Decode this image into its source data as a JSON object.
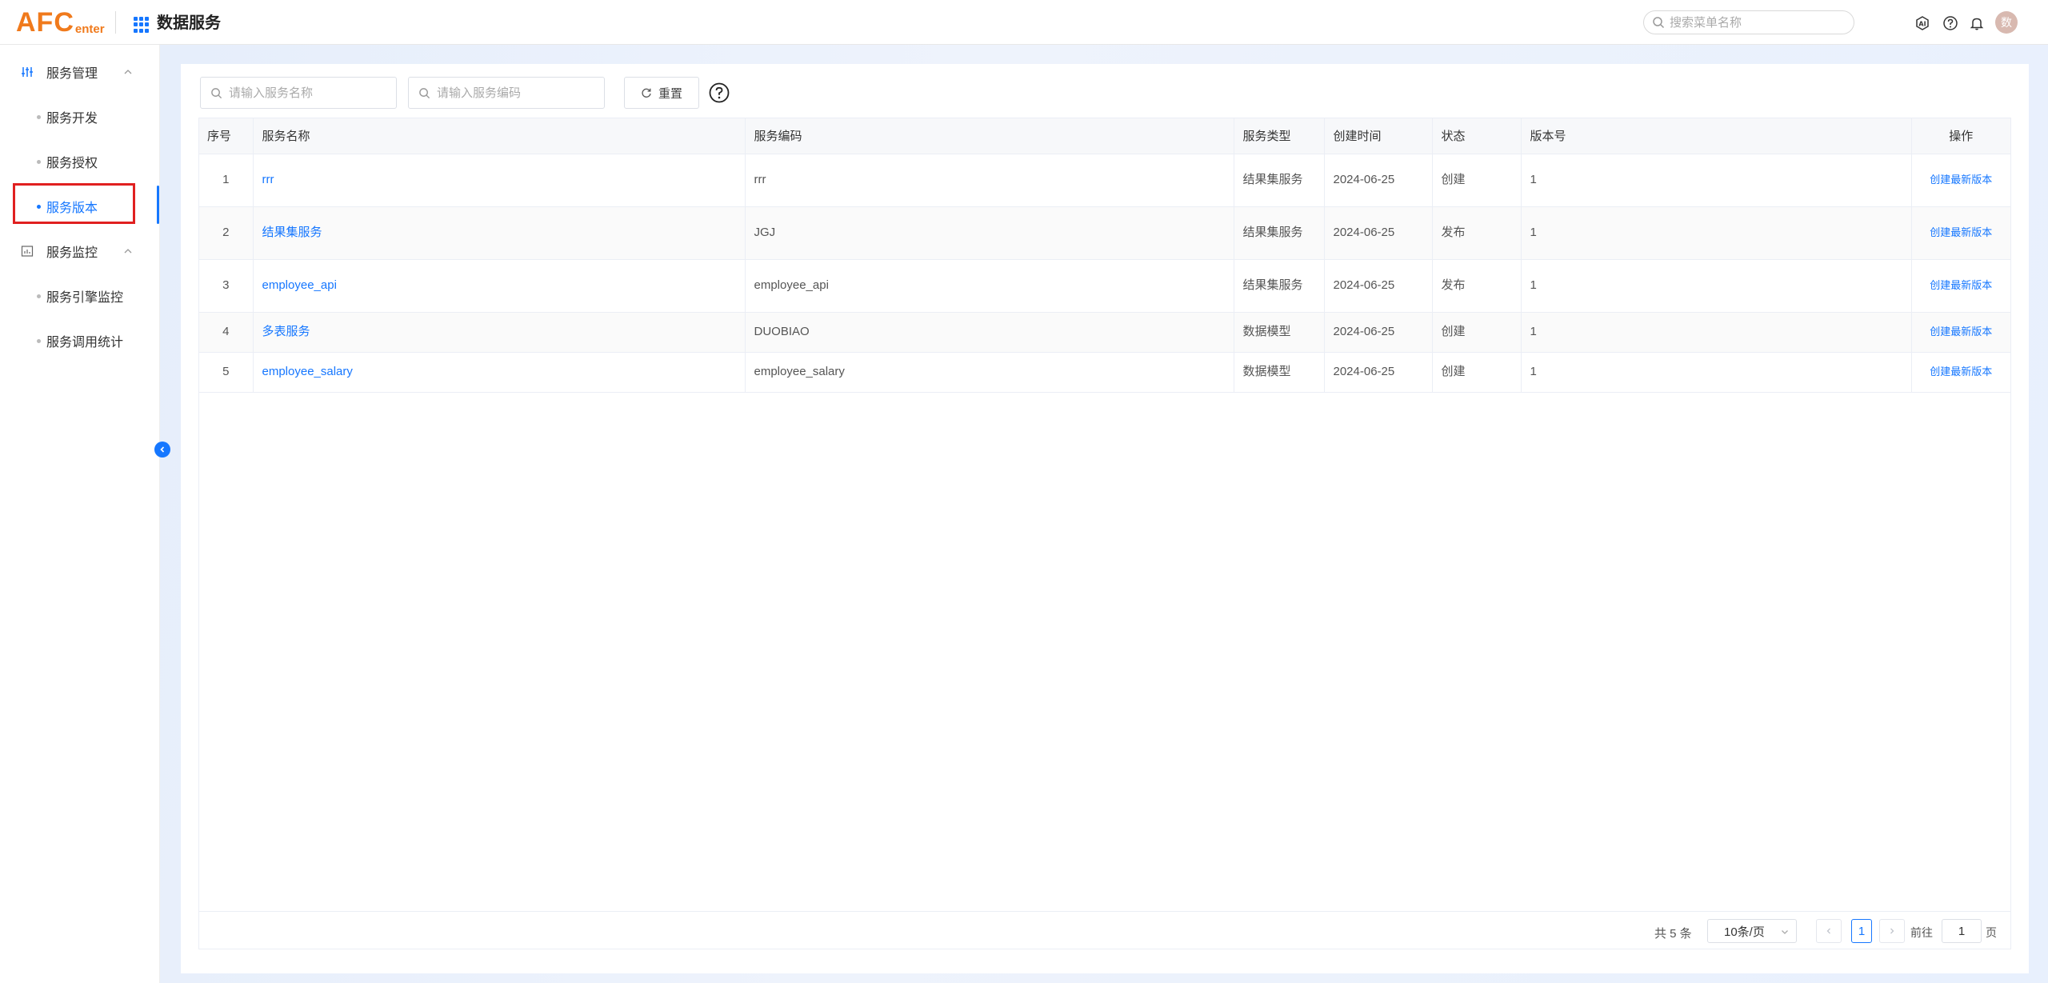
{
  "header": {
    "logo_big": "AFC",
    "logo_small": "enter",
    "app_title": "数据服务",
    "menu_search_placeholder": "搜索菜单名称",
    "avatar_text": "数"
  },
  "sidebar": {
    "groups": [
      {
        "label": "服务管理",
        "items": [
          {
            "label": "服务开发"
          },
          {
            "label": "服务授权"
          },
          {
            "label": "服务版本"
          }
        ]
      },
      {
        "label": "服务监控",
        "items": [
          {
            "label": "服务引擎监控"
          },
          {
            "label": "服务调用统计"
          }
        ]
      }
    ]
  },
  "filters": {
    "name_placeholder": "请输入服务名称",
    "code_placeholder": "请输入服务编码",
    "reset_label": "重置"
  },
  "table": {
    "columns": [
      "序号",
      "服务名称",
      "服务编码",
      "服务类型",
      "创建时间",
      "状态",
      "版本号",
      "操作"
    ],
    "rows": [
      {
        "seq": "1",
        "name": "rrr",
        "code": "rrr",
        "type": "结果集服务",
        "created": "2024-06-25",
        "status": "创建",
        "version": "1",
        "action": "创建最新版本"
      },
      {
        "seq": "2",
        "name": "结果集服务",
        "code": "JGJ",
        "type": "结果集服务",
        "created": "2024-06-25",
        "status": "发布",
        "version": "1",
        "action": "创建最新版本"
      },
      {
        "seq": "3",
        "name": "employee_api",
        "code": "employee_api",
        "type": "结果集服务",
        "created": "2024-06-25",
        "status": "发布",
        "version": "1",
        "action": "创建最新版本"
      },
      {
        "seq": "4",
        "name": "多表服务",
        "code": "DUOBIAO",
        "type": "数据模型",
        "created": "2024-06-25",
        "status": "创建",
        "version": "1",
        "action": "创建最新版本"
      },
      {
        "seq": "5",
        "name": "employee_salary",
        "code": "employee_salary",
        "type": "数据模型",
        "created": "2024-06-25",
        "status": "创建",
        "version": "1",
        "action": "创建最新版本"
      }
    ]
  },
  "pagination": {
    "total_text": "共 5 条",
    "page_size": "10条/页",
    "current_page": "1",
    "goto_label": "前往",
    "goto_value": "1",
    "page_suffix": "页"
  },
  "colors": {
    "accent": "#1677ff",
    "logo": "#f07a1c",
    "highlight_border": "#e02020"
  },
  "icons": [
    "apps-grid-icon",
    "search-icon",
    "ai-icon",
    "help-icon",
    "bell-icon",
    "sliders-icon",
    "chart-icon",
    "chevron-up-icon",
    "chevron-left-icon",
    "refresh-icon",
    "chevron-down-icon",
    "chevron-right-icon"
  ]
}
